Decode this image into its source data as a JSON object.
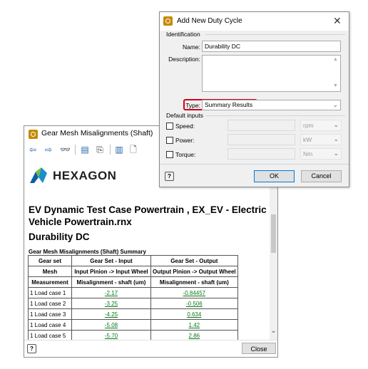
{
  "back_window": {
    "title": "Gear Mesh Misalignments (Shaft)",
    "logo_text": "HEXAGON",
    "doc_title": "EV Dynamic Test Case Powertrain , EX_EV - Electric Vehicle Powertrain.rnx",
    "doc_subtitle": "Durability DC",
    "table_caption": "Gear Mesh Misalignments (Shaft) Summary",
    "table": {
      "headers": {
        "gear_set": "Gear set",
        "input": "Gear Set - Input",
        "output": "Gear Set - Output",
        "mesh": "Mesh",
        "mesh_input": "Input Pinion -> Input Wheel",
        "mesh_output": "Output Pinion -> Output Wheel",
        "measurement": "Measurement",
        "meas_input": "Misalignment - shaft (um)",
        "meas_output": "Misalignment - shaft (um)"
      },
      "rows": [
        {
          "label": "1 Load case 1",
          "input": "-2.17",
          "output": "-0.84457"
        },
        {
          "label": "1 Load case 2",
          "input": "-3.25",
          "output": "-0.506"
        },
        {
          "label": "1 Load case 3",
          "input": "-4.25",
          "output": "0.634"
        },
        {
          "label": "1 Load case 4",
          "input": "-5.08",
          "output": "1.42"
        },
        {
          "label": "1 Load case 5",
          "input": "-5.70",
          "output": "2.86"
        }
      ]
    },
    "close_label": "Close",
    "help_glyph": "?"
  },
  "front_dialog": {
    "title": "Add New Duty Cycle",
    "close_glyph": "✕",
    "identification_label": "Identification",
    "name_label": "Name:",
    "name_value": "Durability DC",
    "description_label": "Description:",
    "description_value": "",
    "type_label": "Type:",
    "type_value": "Summary Results",
    "default_inputs_label": "Default inputs",
    "inputs": [
      {
        "label": "Speed:",
        "unit": "rpm",
        "checked": false
      },
      {
        "label": "Power:",
        "unit": "kW",
        "checked": false
      },
      {
        "label": "Torque:",
        "unit": "Nm",
        "checked": false
      }
    ],
    "ok_label": "OK",
    "cancel_label": "Cancel",
    "help_glyph": "?",
    "highlight_color": "#d0021b"
  }
}
